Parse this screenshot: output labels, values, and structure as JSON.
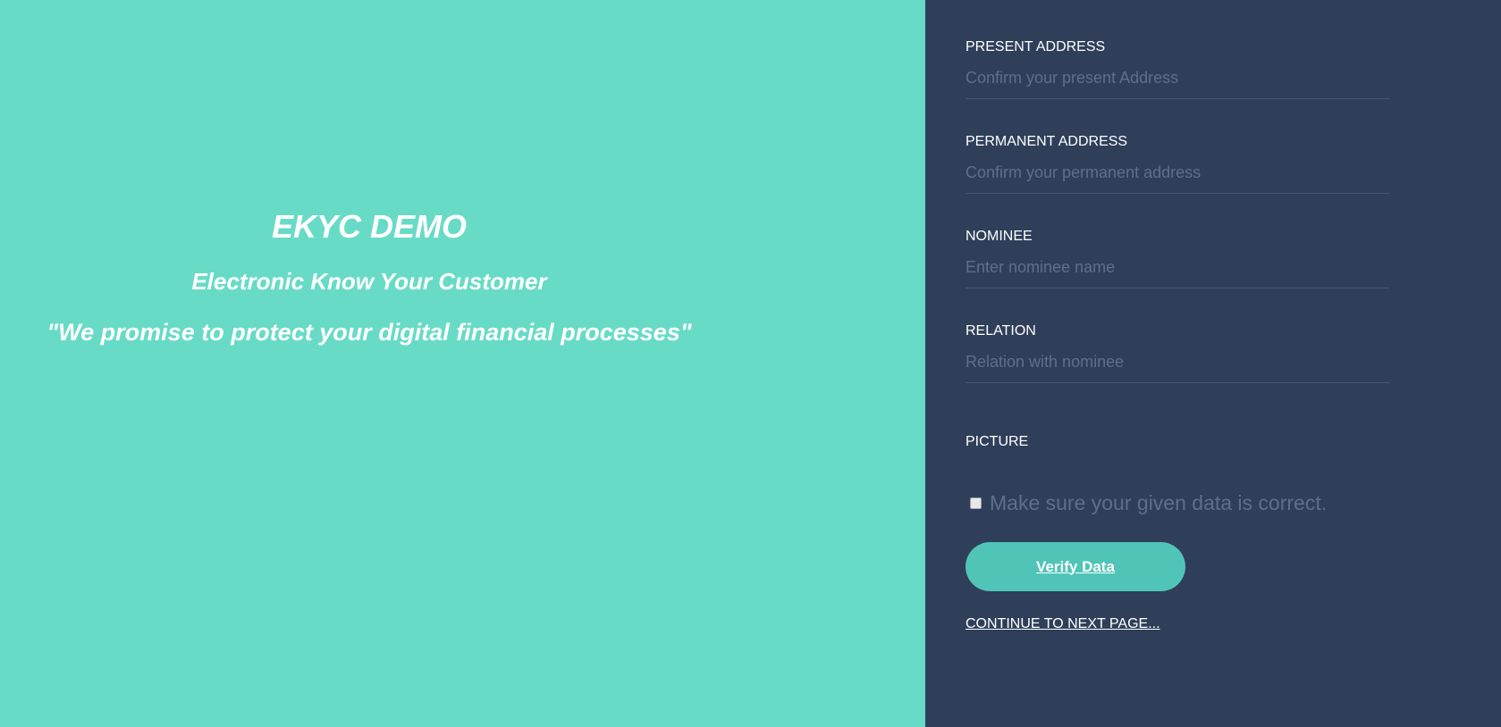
{
  "hero": {
    "title": "EKYC DEMO",
    "subtitle": "Electronic Know Your Customer",
    "tagline": "\"We promise to protect your digital financial processes\"",
    "background_color": "#68dbc7"
  },
  "form": {
    "background_color": "#2f3f5a",
    "fields": [
      {
        "label": "PRESENT ADDRESS",
        "placeholder": "Confirm your present Address",
        "value": ""
      },
      {
        "label": "PERMANENT ADDRESS",
        "placeholder": "Confirm your permanent address",
        "value": ""
      },
      {
        "label": "NOMINEE",
        "placeholder": "Enter nominee name",
        "value": ""
      },
      {
        "label": "RELATION",
        "placeholder": "Relation with nominee",
        "value": ""
      }
    ],
    "picture_label": "PICTURE",
    "confirm_checkbox": {
      "label": "Make sure your given data is correct.",
      "checked": false
    },
    "verify_button_label": "Verify Data",
    "verify_button_color": "#50c5b7",
    "next_link_label": "CONTINUE TO NEXT PAGE..."
  }
}
